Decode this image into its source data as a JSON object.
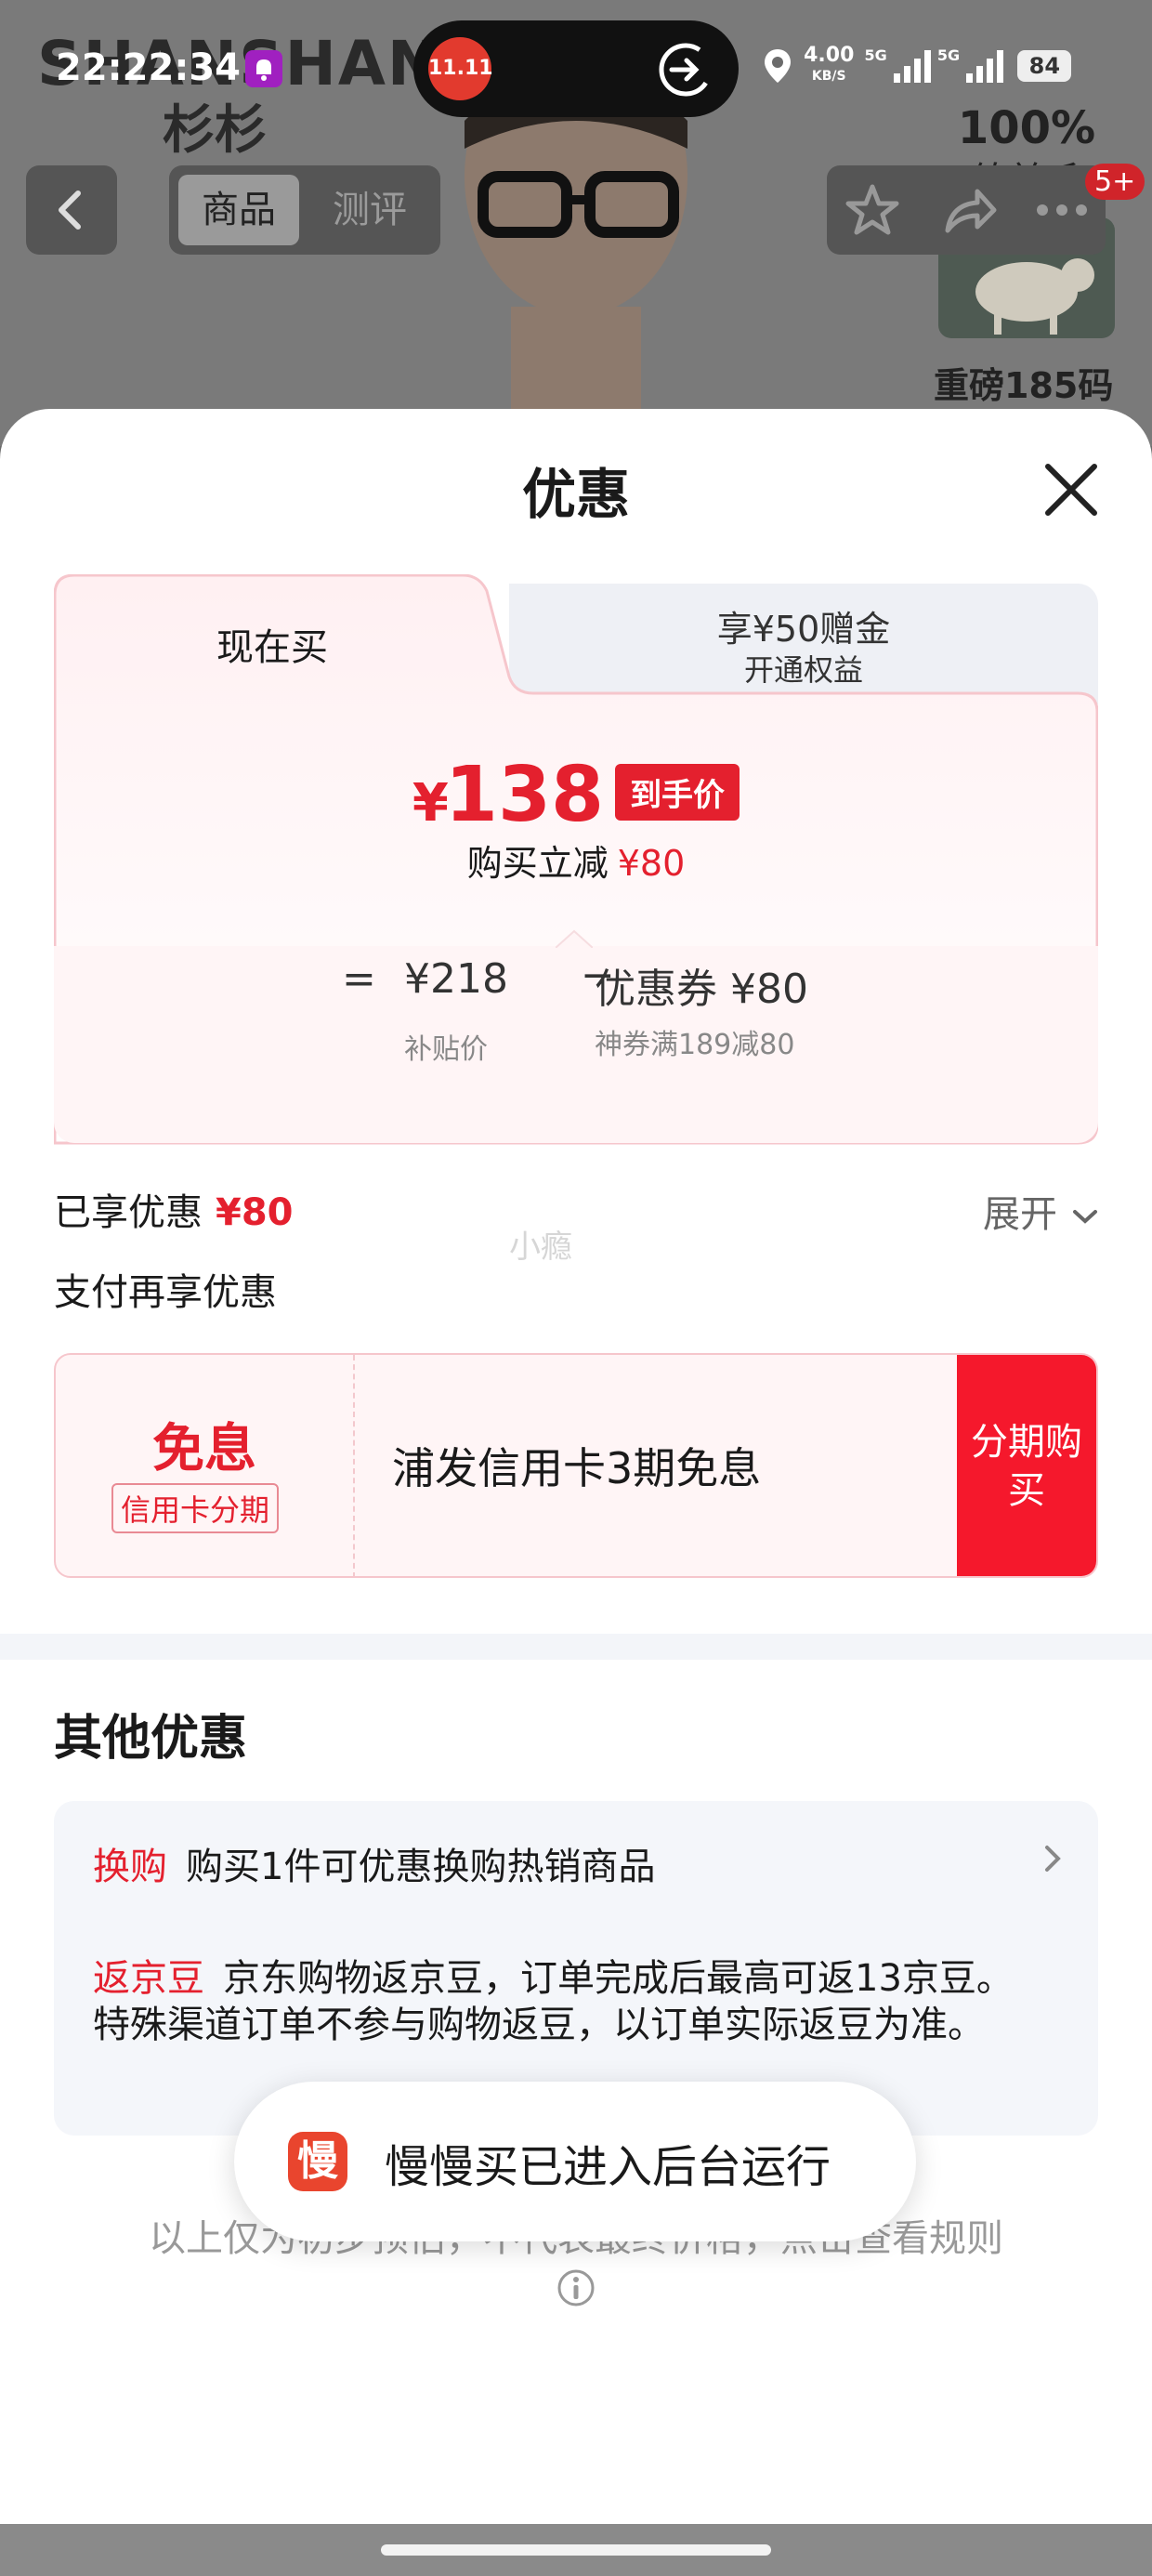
{
  "status_bar": {
    "time": "22:22:34",
    "net_speed_value": "4.00",
    "net_speed_unit": "KB/S",
    "signal1_label": "5G",
    "signal2_label": "5G",
    "battery": "84"
  },
  "island": {
    "app_label": "11.11"
  },
  "background": {
    "brand_en": "SHANSHAN",
    "brand_cn": "杉杉",
    "ad_percent": "100%",
    "ad_material": "绵羊毛",
    "ad_heavy": "重磅185码"
  },
  "nav": {
    "tab_goods": "商品",
    "tab_reviews": "测评",
    "badge": "5+"
  },
  "sheet": {
    "title": "优惠",
    "price_card": {
      "tab_now": "现在买",
      "tab_bonus_line1": "享¥50赠金",
      "tab_bonus_line2": "开通权益",
      "price_symbol": "¥",
      "price_value": "138",
      "price_tag": "到手价",
      "reduce_label": "购买立减",
      "reduce_amount": "¥80",
      "formula_eq": "=",
      "formula_price": "¥218",
      "formula_minus": "−",
      "formula_coupon": "优惠券 ¥80",
      "formula_price_note": "补贴价",
      "formula_coupon_note": "神券满189减80"
    },
    "enjoyed_label": "已享优惠",
    "enjoyed_amount": "¥80",
    "expand_label": "展开",
    "watermark": "小瘾",
    "pay_more_label": "支付再享优惠",
    "installment": {
      "free_label": "免息",
      "tag": "信用卡分期",
      "text": "浦发信用卡3期免息",
      "button": "分期购买"
    },
    "other_title": "其他优惠",
    "other_offers": [
      {
        "key": "换购",
        "text": "购买1件可优惠换购热销商品"
      },
      {
        "key": "返京豆",
        "text": "京东购物返京豆，订单完成后最高可返13京豆。特殊渠道订单不参与购物返豆，以订单实际返豆为准。"
      }
    ],
    "footnote": "以上仅为初步预估，不代表最终价格，点击查看规则"
  },
  "toast": {
    "icon_char": "慢",
    "text": "慢慢买已进入后台运行"
  },
  "colors": {
    "accent_red": "#e4202e",
    "button_red": "#f5182c",
    "card_pink": "#fff5f6"
  }
}
